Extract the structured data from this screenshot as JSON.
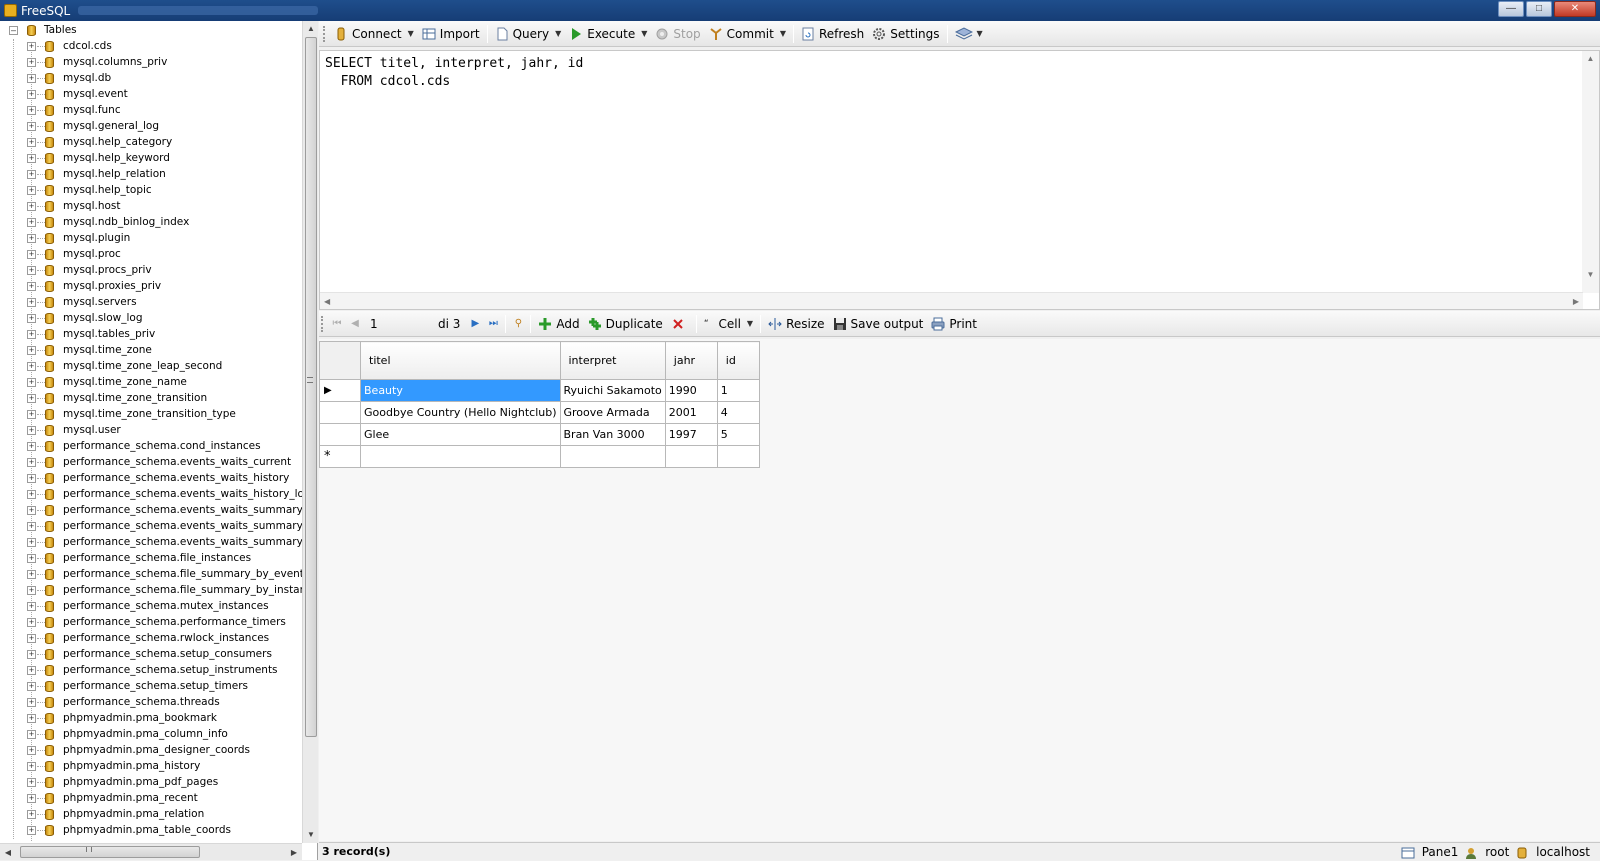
{
  "window": {
    "title": "FreeSQL"
  },
  "tree": {
    "root_label": "Tables",
    "items": [
      "cdcol.cds",
      "mysql.columns_priv",
      "mysql.db",
      "mysql.event",
      "mysql.func",
      "mysql.general_log",
      "mysql.help_category",
      "mysql.help_keyword",
      "mysql.help_relation",
      "mysql.help_topic",
      "mysql.host",
      "mysql.ndb_binlog_index",
      "mysql.plugin",
      "mysql.proc",
      "mysql.procs_priv",
      "mysql.proxies_priv",
      "mysql.servers",
      "mysql.slow_log",
      "mysql.tables_priv",
      "mysql.time_zone",
      "mysql.time_zone_leap_second",
      "mysql.time_zone_name",
      "mysql.time_zone_transition",
      "mysql.time_zone_transition_type",
      "mysql.user",
      "performance_schema.cond_instances",
      "performance_schema.events_waits_current",
      "performance_schema.events_waits_history",
      "performance_schema.events_waits_history_lor",
      "performance_schema.events_waits_summary_b",
      "performance_schema.events_waits_summary_b",
      "performance_schema.events_waits_summary_g",
      "performance_schema.file_instances",
      "performance_schema.file_summary_by_event_r",
      "performance_schema.file_summary_by_instanc",
      "performance_schema.mutex_instances",
      "performance_schema.performance_timers",
      "performance_schema.rwlock_instances",
      "performance_schema.setup_consumers",
      "performance_schema.setup_instruments",
      "performance_schema.setup_timers",
      "performance_schema.threads",
      "phpmyadmin.pma_bookmark",
      "phpmyadmin.pma_column_info",
      "phpmyadmin.pma_designer_coords",
      "phpmyadmin.pma_history",
      "phpmyadmin.pma_pdf_pages",
      "phpmyadmin.pma_recent",
      "phpmyadmin.pma_relation",
      "phpmyadmin.pma_table_coords"
    ]
  },
  "toolbar": {
    "connect": "Connect",
    "import": "Import",
    "query": "Query",
    "execute": "Execute",
    "stop": "Stop",
    "commit": "Commit",
    "refresh": "Refresh",
    "settings": "Settings"
  },
  "editor": {
    "sql": "SELECT titel, interpret, jahr, id\n  FROM cdcol.cds"
  },
  "navigator": {
    "position": "1",
    "of_label": "di 3",
    "add": "Add",
    "duplicate": "Duplicate",
    "cell": "Cell",
    "resize": "Resize",
    "save_output": "Save output",
    "print": "Print"
  },
  "grid": {
    "columns": [
      "titel",
      "interpret",
      "jahr",
      "id"
    ],
    "rows": [
      [
        "Beauty",
        "Ryuichi Sakamoto",
        "1990",
        "1"
      ],
      [
        "Goodbye Country (Hello Nightclub)",
        "Groove Armada",
        "2001",
        "4"
      ],
      [
        "Glee",
        "Bran Van 3000",
        "1997",
        "5"
      ]
    ],
    "new_row_marker": "*"
  },
  "status": {
    "records": "3 record(s)",
    "pane": "Pane1",
    "user": "root",
    "host": "localhost"
  },
  "colors": {
    "selection": "#3399ff",
    "titlebar": "#1f4e8c",
    "execute_green": "#2a9a2a"
  }
}
